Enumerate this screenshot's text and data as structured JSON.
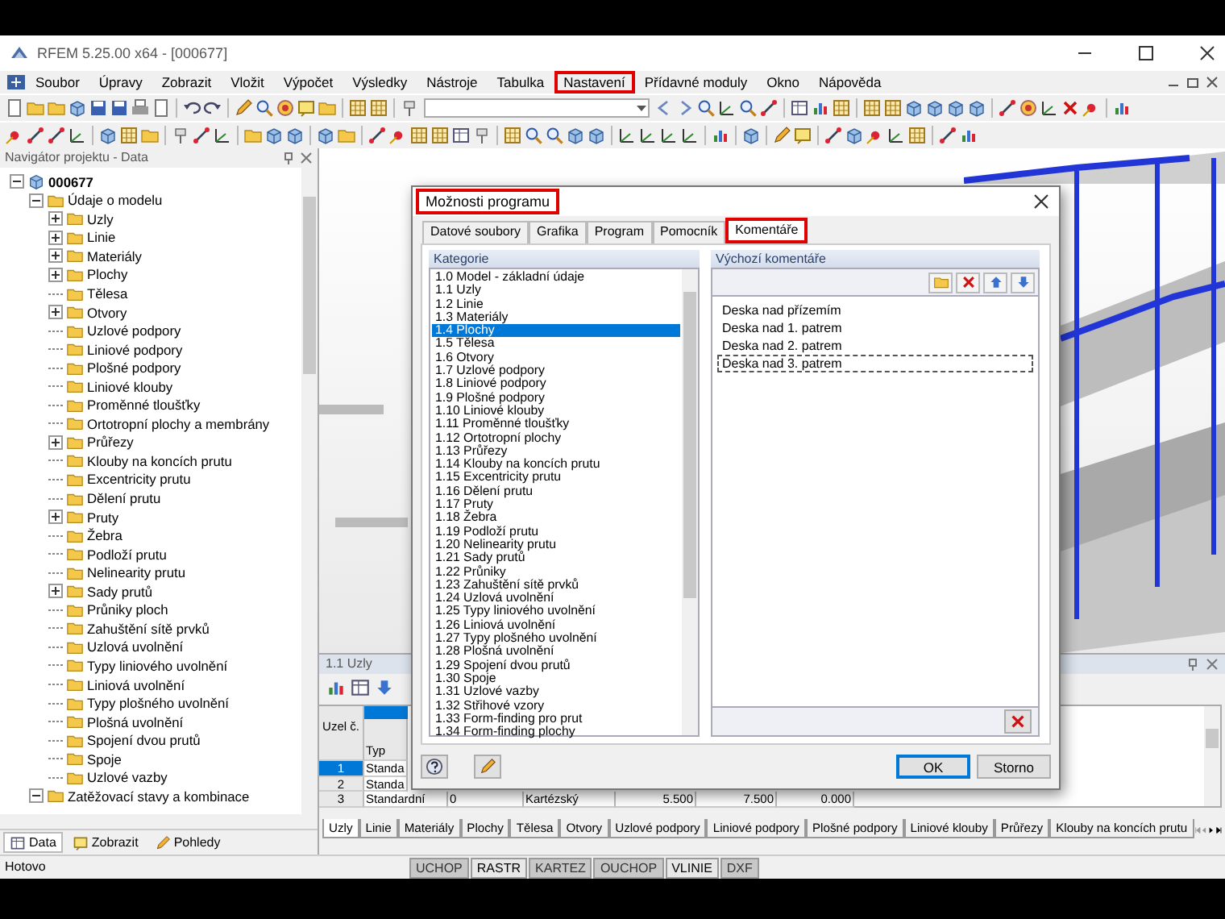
{
  "window": {
    "title": "RFEM 5.25.00 x64 - [000677]"
  },
  "menu": [
    {
      "label": "Soubor",
      "highlighted": false
    },
    {
      "label": "Úpravy",
      "highlighted": false
    },
    {
      "label": "Zobrazit",
      "highlighted": false
    },
    {
      "label": "Vložit",
      "highlighted": false
    },
    {
      "label": "Výpočet",
      "highlighted": false
    },
    {
      "label": "Výsledky",
      "highlighted": false
    },
    {
      "label": "Nástroje",
      "highlighted": false
    },
    {
      "label": "Tabulka",
      "highlighted": false
    },
    {
      "label": "Nastavení",
      "highlighted": true
    },
    {
      "label": "Přídavné moduly",
      "highlighted": false
    },
    {
      "label": "Okno",
      "highlighted": false
    },
    {
      "label": "Nápověda",
      "highlighted": false
    }
  ],
  "navigator": {
    "title": "Navigátor projektu - Data",
    "tree": [
      {
        "label": "000677",
        "expandable": true,
        "expanded": true,
        "children": [
          {
            "label": "Údaje o modelu",
            "expandable": true,
            "expanded": true,
            "children": [
              {
                "label": "Uzly",
                "expandable": true,
                "expanded": false
              },
              {
                "label": "Linie",
                "expandable": true,
                "expanded": false
              },
              {
                "label": "Materiály",
                "expandable": true,
                "expanded": false
              },
              {
                "label": "Plochy",
                "expandable": true,
                "expanded": false
              },
              {
                "label": "Tělesa",
                "expandable": false
              },
              {
                "label": "Otvory",
                "expandable": true,
                "expanded": false
              },
              {
                "label": "Uzlové podpory",
                "expandable": false
              },
              {
                "label": "Liniové podpory",
                "expandable": false
              },
              {
                "label": "Plošné podpory",
                "expandable": false
              },
              {
                "label": "Liniové klouby",
                "expandable": false
              },
              {
                "label": "Proměnné tloušťky",
                "expandable": false
              },
              {
                "label": "Ortotropní plochy a membrány",
                "expandable": false
              },
              {
                "label": "Průřezy",
                "expandable": true,
                "expanded": false
              },
              {
                "label": "Klouby na koncích prutu",
                "expandable": false
              },
              {
                "label": "Excentricity prutu",
                "expandable": false
              },
              {
                "label": "Dělení prutu",
                "expandable": false
              },
              {
                "label": "Pruty",
                "expandable": true,
                "expanded": false
              },
              {
                "label": "Žebra",
                "expandable": false
              },
              {
                "label": "Podloží prutu",
                "expandable": false
              },
              {
                "label": "Nelinearity prutu",
                "expandable": false
              },
              {
                "label": "Sady prutů",
                "expandable": true,
                "expanded": false
              },
              {
                "label": "Průniky ploch",
                "expandable": false
              },
              {
                "label": "Zahuštění sítě prvků",
                "expandable": false
              },
              {
                "label": "Uzlová uvolnění",
                "expandable": false
              },
              {
                "label": "Typy liniového uvolnění",
                "expandable": false
              },
              {
                "label": "Liniová uvolnění",
                "expandable": false
              },
              {
                "label": "Typy plošného uvolnění",
                "expandable": false
              },
              {
                "label": "Plošná uvolnění",
                "expandable": false
              },
              {
                "label": "Spojení dvou prutů",
                "expandable": false
              },
              {
                "label": "Spoje",
                "expandable": false
              },
              {
                "label": "Uzlové vazby",
                "expandable": false
              }
            ]
          },
          {
            "label": "Zatěžovací stavy a kombinace",
            "expandable": true,
            "expanded": true
          }
        ]
      }
    ],
    "tabs": [
      {
        "label": "Data",
        "selected": true
      },
      {
        "label": "Zobrazit",
        "selected": false
      },
      {
        "label": "Pohledy",
        "selected": false
      }
    ]
  },
  "table_panel": {
    "title": "1.1 Uzly",
    "columns": [
      {
        "label": "Uzel č."
      },
      {
        "label": "Typ"
      }
    ],
    "rows": [
      {
        "cells": [
          "1",
          "Standa"
        ],
        "selected": true
      },
      {
        "cells": [
          "2",
          "Standa"
        ],
        "selected": false
      },
      {
        "cells": [
          "3",
          "Standardní",
          "0",
          "Kartézský",
          "5.500",
          "7.500",
          "0.000"
        ],
        "selected": false
      }
    ],
    "sheets": [
      {
        "label": "Uzly",
        "selected": true
      },
      {
        "label": "Linie",
        "selected": false
      },
      {
        "label": "Materiály",
        "selected": false
      },
      {
        "label": "Plochy",
        "selected": false
      },
      {
        "label": "Tělesa",
        "selected": false
      },
      {
        "label": "Otvory",
        "selected": false
      },
      {
        "label": "Uzlové podpory",
        "selected": false
      },
      {
        "label": "Liniové podpory",
        "selected": false
      },
      {
        "label": "Plošné podpory",
        "selected": false
      },
      {
        "label": "Liniové klouby",
        "selected": false
      },
      {
        "label": "Průřezy",
        "selected": false
      },
      {
        "label": "Klouby na koncích prutu",
        "selected": false
      }
    ]
  },
  "status_bar": {
    "text": "Hotovo",
    "toggles": [
      {
        "label": "UCHOP",
        "on": false
      },
      {
        "label": "RASTR",
        "on": true
      },
      {
        "label": "KARTEZ",
        "on": false
      },
      {
        "label": "OUCHOP",
        "on": false
      },
      {
        "label": "VLINIE",
        "on": true
      },
      {
        "label": "DXF",
        "on": false
      }
    ]
  },
  "dialog": {
    "title": "Možnosti programu",
    "title_highlighted": true,
    "tabs": [
      {
        "label": "Datové soubory",
        "selected": false,
        "highlighted": false
      },
      {
        "label": "Grafika",
        "selected": false,
        "highlighted": false
      },
      {
        "label": "Program",
        "selected": false,
        "highlighted": false
      },
      {
        "label": "Pomocník",
        "selected": false,
        "highlighted": false
      },
      {
        "label": "Komentáře",
        "selected": true,
        "highlighted": true
      }
    ],
    "categories_label": "Kategorie",
    "categories": [
      {
        "label": "1.0 Model - základní údaje",
        "selected": false
      },
      {
        "label": "1.1 Uzly",
        "selected": false
      },
      {
        "label": "1.2 Linie",
        "selected": false
      },
      {
        "label": "1.3 Materiály",
        "selected": false
      },
      {
        "label": "1.4 Plochy",
        "selected": true
      },
      {
        "label": "1.5 Tělesa",
        "selected": false
      },
      {
        "label": "1.6 Otvory",
        "selected": false
      },
      {
        "label": "1.7 Uzlové podpory",
        "selected": false
      },
      {
        "label": "1.8 Liniové podpory",
        "selected": false
      },
      {
        "label": "1.9 Plošné podpory",
        "selected": false
      },
      {
        "label": "1.10 Liniové klouby",
        "selected": false
      },
      {
        "label": "1.11 Proměnné tloušťky",
        "selected": false
      },
      {
        "label": "1.12 Ortotropní plochy",
        "selected": false
      },
      {
        "label": "1.13 Průřezy",
        "selected": false
      },
      {
        "label": "1.14 Klouby na koncích prutu",
        "selected": false
      },
      {
        "label": "1.15 Excentricity prutu",
        "selected": false
      },
      {
        "label": "1.16 Dělení prutu",
        "selected": false
      },
      {
        "label": "1.17 Pruty",
        "selected": false
      },
      {
        "label": "1.18 Žebra",
        "selected": false
      },
      {
        "label": "1.19 Podloží prutu",
        "selected": false
      },
      {
        "label": "1.20 Nelinearity prutu",
        "selected": false
      },
      {
        "label": "1.21 Sady prutů",
        "selected": false
      },
      {
        "label": "1.22 Průniky",
        "selected": false
      },
      {
        "label": "1.23 Zahuštění sítě prvků",
        "selected": false
      },
      {
        "label": "1.24 Uzlová uvolnění",
        "selected": false
      },
      {
        "label": "1.25 Typy liniového uvolnění",
        "selected": false
      },
      {
        "label": "1.26 Liniová uvolnění",
        "selected": false
      },
      {
        "label": "1.27 Typy plošného uvolnění",
        "selected": false
      },
      {
        "label": "1.28 Plošná uvolnění",
        "selected": false
      },
      {
        "label": "1.29 Spojení dvou prutů",
        "selected": false
      },
      {
        "label": "1.30 Spoje",
        "selected": false
      },
      {
        "label": "1.31 Uzlové vazby",
        "selected": false
      },
      {
        "label": "1.32 Střihové vzory",
        "selected": false
      },
      {
        "label": "1.33 Form-finding pro prut",
        "selected": false
      },
      {
        "label": "1.34 Form-finding plochy",
        "selected": false
      }
    ],
    "comments_label": "Výchozí komentáře",
    "comments": [
      {
        "text": "Deska nad přízemím",
        "focused": false
      },
      {
        "text": "Deska nad 1. patrem",
        "focused": false
      },
      {
        "text": "Deska nad 2. patrem",
        "focused": false
      },
      {
        "text": "Deska nad 3. patrem",
        "focused": true
      }
    ],
    "buttons": [
      {
        "label": "OK",
        "default": true
      },
      {
        "label": "Storno",
        "default": false
      }
    ]
  }
}
